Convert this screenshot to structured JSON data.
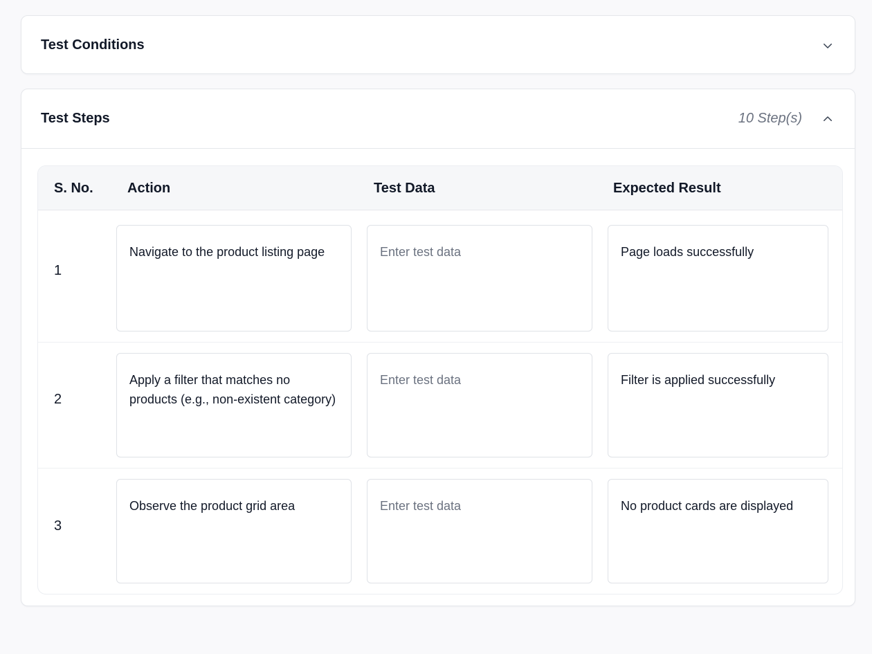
{
  "conditions": {
    "title": "Test Conditions",
    "toggle_icon": "chevron-down-icon"
  },
  "steps": {
    "title": "Test Steps",
    "count_label": "10 Step(s)",
    "toggle_icon": "chevron-up-icon",
    "columns": {
      "sno": "S. No.",
      "action": "Action",
      "test_data": "Test Data",
      "expected_result": "Expected Result"
    },
    "test_data_placeholder": "Enter test data",
    "rows": [
      {
        "sno": "1",
        "action": "Navigate to the product listing page",
        "test_data": "",
        "expected_result": "Page loads successfully"
      },
      {
        "sno": "2",
        "action": "Apply a filter that matches no products (e.g., non-existent category)",
        "test_data": "",
        "expected_result": "Filter is applied successfully"
      },
      {
        "sno": "3",
        "action": "Observe the product grid area",
        "test_data": "",
        "expected_result": "No product cards are displayed"
      }
    ]
  },
  "colors": {
    "background": "#f9f9fb",
    "card": "#ffffff",
    "border": "#e5e7eb",
    "text": "#111827",
    "muted": "#6b7280"
  }
}
